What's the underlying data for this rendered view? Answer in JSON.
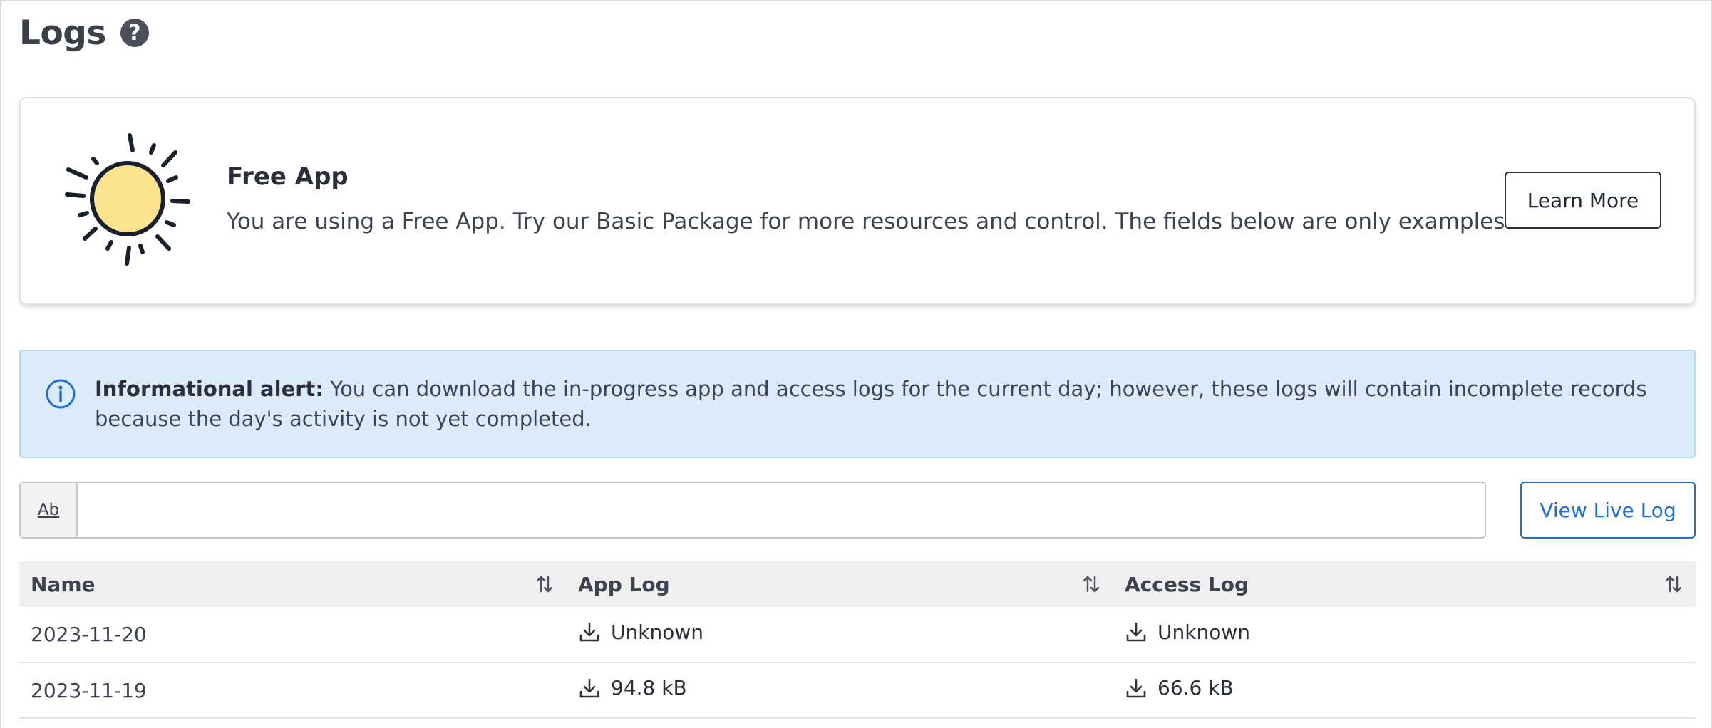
{
  "header": {
    "title": "Logs",
    "help_icon": "question-circle-icon"
  },
  "promo": {
    "title": "Free App",
    "text": "You are using a Free App. Try our Basic Package for more resources and control. The fields below are only examples.",
    "button_label": "Learn More",
    "icon": "sun-icon",
    "sun_color": "#fde38f"
  },
  "alert": {
    "icon": "info-icon",
    "label": "Informational alert:",
    "text": " You can download the in-progress app and access logs for the current day; however, these logs will contain incomplete records because the day's activity is not yet completed.",
    "background": "#dcebfa"
  },
  "search": {
    "prefix_label": "Ab",
    "value": "",
    "placeholder": ""
  },
  "view_live_label": "View Live Log",
  "table": {
    "columns": [
      "Name",
      "App Log",
      "Access Log"
    ],
    "rows": [
      {
        "name": "2023-11-20",
        "app_log": "Unknown",
        "access_log": "Unknown"
      },
      {
        "name": "2023-11-19",
        "app_log": "94.8 kB",
        "access_log": "66.6 kB"
      }
    ]
  },
  "colors": {
    "accent": "#1f6fd1",
    "text": "#3d4250"
  }
}
